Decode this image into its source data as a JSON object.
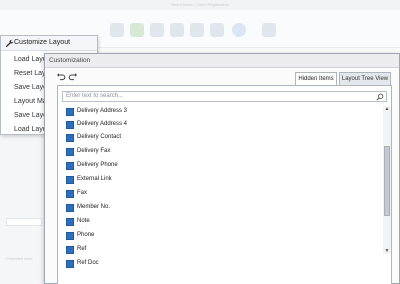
{
  "background_app": {
    "window_title": "New Entries - Client Registration",
    "side_note": "Protected Area"
  },
  "context_menu": {
    "header": "Customize Layout",
    "items": [
      {
        "label": "Load Layout"
      },
      {
        "label": "Reset Layout"
      },
      {
        "label": "Save Layout"
      },
      {
        "label": "Layout Manager"
      },
      {
        "label": "Save Layout As"
      },
      {
        "label": "Load Layout From"
      }
    ]
  },
  "dialog": {
    "title": "Customization",
    "tabs": [
      {
        "label": "Hidden Items",
        "active": true
      },
      {
        "label": "Layout Tree View",
        "active": false
      }
    ],
    "search": {
      "placeholder": "Enter text to search...",
      "value": ""
    },
    "items": [
      {
        "label": "Delivery Address 3"
      },
      {
        "label": "Delivery Address 4"
      },
      {
        "label": "Delivery Contact"
      },
      {
        "label": "Delivery Fax"
      },
      {
        "label": "Delivery Phone"
      },
      {
        "label": "External Link"
      },
      {
        "label": "Fax"
      },
      {
        "label": "Member No."
      },
      {
        "label": "Note"
      },
      {
        "label": "Phone"
      },
      {
        "label": "Ref"
      },
      {
        "label": "Ref Doc"
      }
    ],
    "scroll": {
      "position_fraction": 0.3
    }
  },
  "colors": {
    "item_icon": "#2f6fb8",
    "accent": "#3a7bd5"
  }
}
